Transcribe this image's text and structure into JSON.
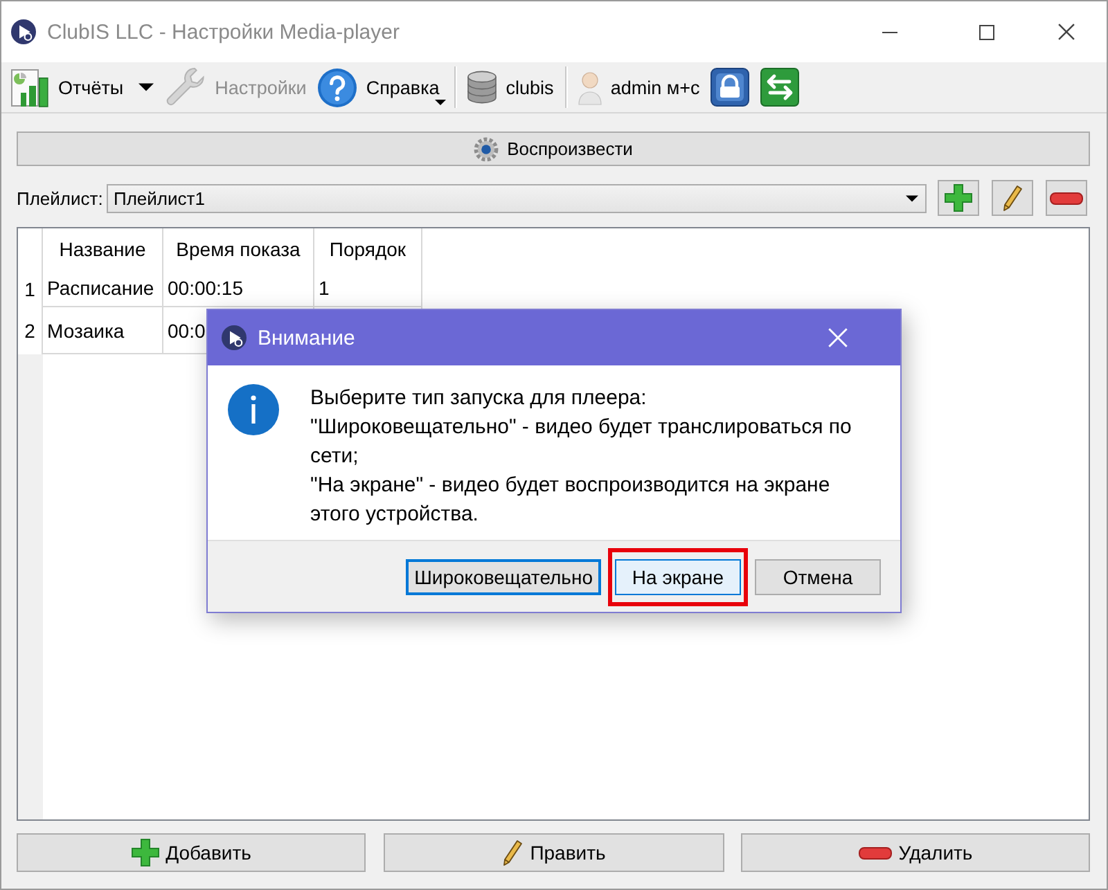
{
  "window": {
    "title": "ClubIS LLC - Настройки Media-player"
  },
  "toolbar": {
    "groups": [
      {
        "items": [
          {
            "kind": "dropdown",
            "label": "Отчёты",
            "disabled": false
          },
          {
            "kind": "button",
            "label": "Настройки",
            "disabled": true
          },
          {
            "kind": "menu",
            "label": "Справка",
            "disabled": false
          }
        ]
      },
      {
        "items": [
          {
            "kind": "button",
            "label": "clubis",
            "disabled": false
          }
        ]
      },
      {
        "items": [
          {
            "kind": "button",
            "label": "admin м+с",
            "disabled": false
          },
          {
            "kind": "icon",
            "disabled": false
          },
          {
            "kind": "icon",
            "disabled": false
          }
        ]
      }
    ]
  },
  "play_button": {
    "label": "Воспроизвести"
  },
  "playlist": {
    "label": "Плейлист:",
    "value": "Плейлист1"
  },
  "table": {
    "columns": [
      "Название",
      "Время показа",
      "Порядок"
    ],
    "rows": [
      {
        "number": "1",
        "cells": [
          "Расписание",
          "00:00:15",
          "1"
        ]
      },
      {
        "number": "2",
        "cells": [
          "Мозаика",
          "00:0"
        ]
      }
    ]
  },
  "actions": [
    {
      "label": "Добавить"
    },
    {
      "label": "Править"
    },
    {
      "label": "Удалить"
    }
  ],
  "dialog": {
    "title": "Внимание",
    "message": [
      "Выберите тип запуска для плеера:",
      "\"Широковещательно\" - видео будет транслироваться по сети;",
      "\"На экране\" - видео будет воспроизводится на экране этого устройства."
    ],
    "buttons": [
      {
        "label": "Широковещательно",
        "focused": true,
        "hovered": false,
        "highlighted": false
      },
      {
        "label": "На экране",
        "focused": false,
        "hovered": true,
        "highlighted": true
      },
      {
        "label": "Отмена",
        "focused": false,
        "hovered": false,
        "highlighted": false
      }
    ]
  }
}
